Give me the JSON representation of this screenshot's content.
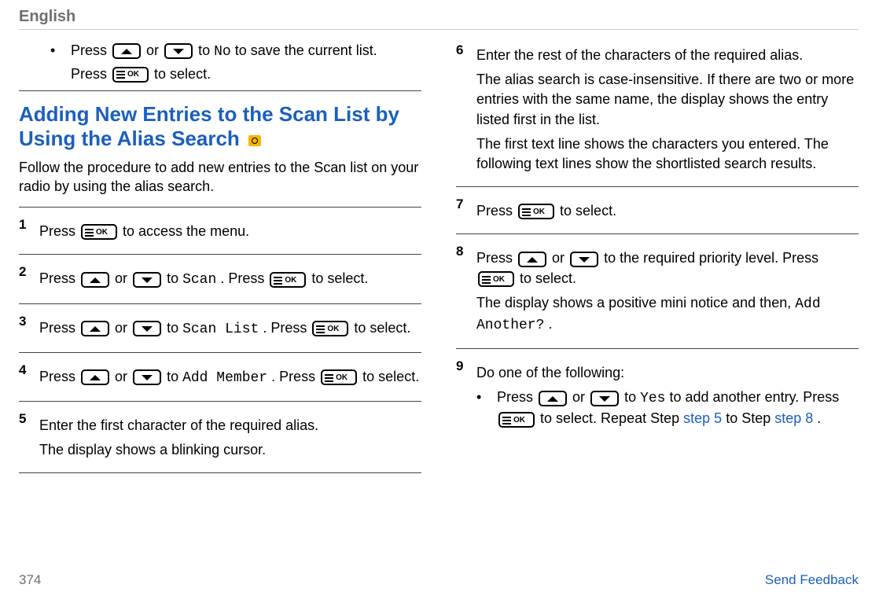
{
  "header": {
    "language": "English"
  },
  "col_left": {
    "prev_end": {
      "bullet": "•",
      "line1a": "Press ",
      "line1b": " or ",
      "line1c": " to ",
      "no_label": "No",
      "line1d": " to save the current list.",
      "line2a": "Press ",
      "line2b": " to select."
    },
    "section_title": "Adding New Entries to the Scan List by Using the Alias Search",
    "intro": "Follow the procedure to add new entries to the Scan list on your radio by using the alias search.",
    "steps": {
      "s1": {
        "num": "1",
        "a": "Press ",
        "b": " to access the menu."
      },
      "s2": {
        "num": "2",
        "a": "Press ",
        "b": " or ",
        "c": " to ",
        "scan": "Scan",
        "d": ". Press ",
        "e": " to select."
      },
      "s3": {
        "num": "3",
        "a": "Press ",
        "b": " or ",
        "c": " to ",
        "scan_list": "Scan List",
        "d": ". Press ",
        "e": " to select."
      },
      "s4": {
        "num": "4",
        "a": "Press ",
        "b": " or ",
        "c": " to ",
        "add_member": "Add Member",
        "d": ". Press ",
        "e": " to select."
      },
      "s5": {
        "num": "5",
        "l1": "Enter the first character of the required alias.",
        "l2": "The display shows a blinking cursor."
      }
    }
  },
  "col_right": {
    "s6": {
      "num": "6",
      "l1": "Enter the rest of the characters of the required alias.",
      "l2": "The alias search is case-insensitive. If there are two or more entries with the same name, the display shows the entry listed first in the list.",
      "l3": "The first text line shows the characters you entered. The following text lines show the shortlisted search results."
    },
    "s7": {
      "num": "7",
      "a": "Press ",
      "b": " to select."
    },
    "s8": {
      "num": "8",
      "a": "Press ",
      "b": " or ",
      "c": " to the required priority level. Press ",
      "d": " to select.",
      "l2a": "The display shows a positive mini notice and then, ",
      "add_another": "Add Another?",
      "l2b": "."
    },
    "s9": {
      "num": "9",
      "l1": "Do one of the following:",
      "bullet": "•",
      "sub_a": "Press ",
      "sub_b": " or ",
      "sub_c": " to ",
      "yes": "Yes",
      "sub_d": " to add another entry. Press ",
      "sub_e": " to select. Repeat Step ",
      "link5": "step 5",
      "sub_f": " to Step ",
      "link8": "step 8",
      "sub_g": "."
    }
  },
  "footer": {
    "page": "374",
    "feedback": "Send Feedback"
  },
  "icons": {
    "ok_label": "OK"
  }
}
